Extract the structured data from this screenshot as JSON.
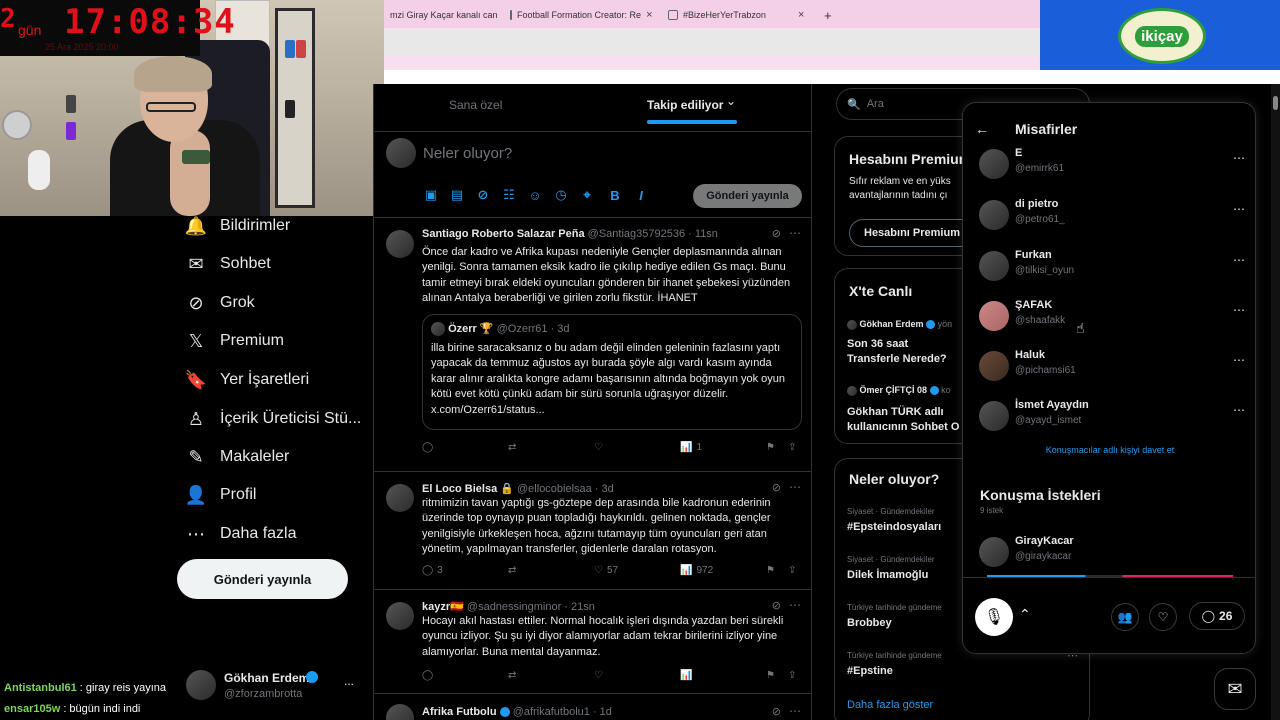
{
  "overlay": {
    "clock_day": "2",
    "clock_gun": "gün",
    "clock_time": "17:08:34",
    "clock_date": "25 Ara 2025   20:00"
  },
  "browser": {
    "tabs": [
      {
        "label": "mzi Giray Kaçar kanalı can",
        "close": "×"
      },
      {
        "label": "Football Formation Creator: Re",
        "close": "×"
      },
      {
        "label": "#BizeHerYerTrabzon",
        "close": "×"
      }
    ],
    "new_tab": "+",
    "banner_logo": "ikiçay"
  },
  "nav": {
    "items": [
      {
        "label": "Bildirimler",
        "icon": "bell-icon",
        "glyph": "🔔"
      },
      {
        "label": "Sohbet",
        "icon": "envelope-icon",
        "glyph": "✉"
      },
      {
        "label": "Grok",
        "icon": "grok-icon",
        "glyph": "⊘"
      },
      {
        "label": "Premium",
        "icon": "x-logo-icon",
        "glyph": "𝕏"
      },
      {
        "label": "Yer İşaretleri",
        "icon": "bookmark-icon",
        "glyph": "🔖"
      },
      {
        "label": "İçerik Üreticisi Stü...",
        "icon": "creator-studio-icon",
        "glyph": "♙"
      },
      {
        "label": "Makaleler",
        "icon": "articles-icon",
        "glyph": "✎"
      },
      {
        "label": "Profil",
        "icon": "person-icon",
        "glyph": "👤"
      },
      {
        "label": "Daha fazla",
        "icon": "more-circle-icon",
        "glyph": "⋯"
      }
    ],
    "post_button": "Gönderi yayınla",
    "account_name": "Gökhan Erdem",
    "account_handle": "@zforzambrotta",
    "account_more": "..."
  },
  "chat": [
    {
      "user": "Antistanbul61",
      "text": " : giray reis yayına"
    },
    {
      "user": "ensar105w",
      "text": " : bügün indi indi"
    }
  ],
  "main": {
    "tabs": [
      "Sana özel",
      "Takip ediliyor"
    ],
    "tab_chevron": "⌄",
    "composer_placeholder": "Neler oluyor?",
    "composer_post": "Gönderi yayınla",
    "tweets": [
      {
        "name": "Santiago Roberto Salazar Peña",
        "handle": "@Santiag35792536 · 11sn",
        "body": "Önce dar kadro ve Afrika kupası nedeniyle Gençler deplasmanında alınan yenilgi. Sonra tamamen eksik kadro ile çıkılıp hediye edilen Gs maçı. Bunu tamir etmeyi bırak eldeki oyuncuları gönderen bir ihanet şebekesi yüzünden alınan Antalya beraberliği ve girilen zorlu fikstür. İHANET",
        "quote_name": "Özerr 🏆",
        "quote_handle": "@Ozerr61 · 3d",
        "quote_body": "illa birine saracaksanız o bu adam değil elinden geleninin fazlasını yaptı yapacak da temmuz ağustos ayı burada şöyle algı vardı kasım ayında karar alınır aralıkta kongre adamı başarısının altında boğmayın yok oyun kötü evet kötü çünkü adam bir sürü sorunla uğraşıyor düzelir. x.com/Ozerr61/status...",
        "views": "1",
        "replies": "",
        "likes": ""
      },
      {
        "name": "El Loco Bielsa 🔒",
        "handle": "@ellocobielsaa · 3d",
        "body": "ritmimizin tavan yaptığı gs-göztepe dep arasında bile kadronun ederinin üzerinde top oynayıp puan topladığı haykırıldı. gelinen noktada, gençler yenilgisiyle ürkekleşen hoca, ağzını tutamayıp tüm oyuncuları geri atan yönetim, yapılmayan transferler, gidenlerle daralan rotasyon.",
        "replies": "3",
        "likes": "57",
        "views": "972"
      },
      {
        "name": "kayzr🇪🇸",
        "handle": "@sadnessingminor · 21sn",
        "body": "Hocayı akıl hastası ettiler. Normal hocalık işleri dışında yazdan beri sürekli oyuncu izliyor. Şu şu iyi diyor alamıyorlar adam tekrar birilerini izliyor yine alamıyorlar. Buna mental dayanmaz."
      },
      {
        "name": "Afrika Futbolu",
        "handle": "@afrikafutbolu1 · 1d"
      }
    ]
  },
  "right": {
    "search_placeholder": "Ara",
    "premium_title": "Hesabını Premium",
    "premium_text": "Sıfır reklam ve en yüks avantajlarının tadını çı",
    "premium_button": "Hesabını Premium",
    "live_title": "X'te Canlı",
    "live": [
      {
        "host": "Gökhan Erdem",
        "suffix": "yön",
        "title": "Son 36 saat Transferle Nerede?"
      },
      {
        "host": "Ömer ÇİFTÇİ 08",
        "suffix": "ko",
        "title": "Gökhan TÜRK adlı kullanıcının Sohbet O"
      }
    ],
    "trends_title": "Neler oluyor?",
    "trends": [
      {
        "meta": "Siyaset · Gündemdekiler",
        "name": "#Epsteindosyaları"
      },
      {
        "meta": "Siyaset · Gündemdekiler",
        "name": "Dilek İmamoğlu"
      },
      {
        "meta": "Türkiye tarihinde gündeme",
        "name": "Brobbey"
      },
      {
        "meta": "Türkiye tarihinde gündeme",
        "name": "#Epstine"
      }
    ],
    "show_more": "Daha fazla göster"
  },
  "spaces": {
    "back": "←",
    "title": "Misafirler",
    "guests": [
      {
        "name": "E",
        "handle": "@emirrk61"
      },
      {
        "name": "di pietro",
        "handle": "@petro61_"
      },
      {
        "name": "Furkan",
        "handle": "@tilkisi_oyun"
      },
      {
        "name": "ŞAFAK",
        "handle": "@shaafakk"
      },
      {
        "name": "Haluk",
        "handle": "@pichamsi61"
      },
      {
        "name": "İsmet Ayaydın",
        "handle": "@ayayd_ismet"
      }
    ],
    "invite": "Konuşmacılar adlı kişiyi davet et",
    "requests_title": "Konuşma İstekleri",
    "requests_count": "9 istek",
    "request_user_name": "GirayKacar",
    "request_user_handle": "@giraykacar",
    "comment_count": "26"
  }
}
